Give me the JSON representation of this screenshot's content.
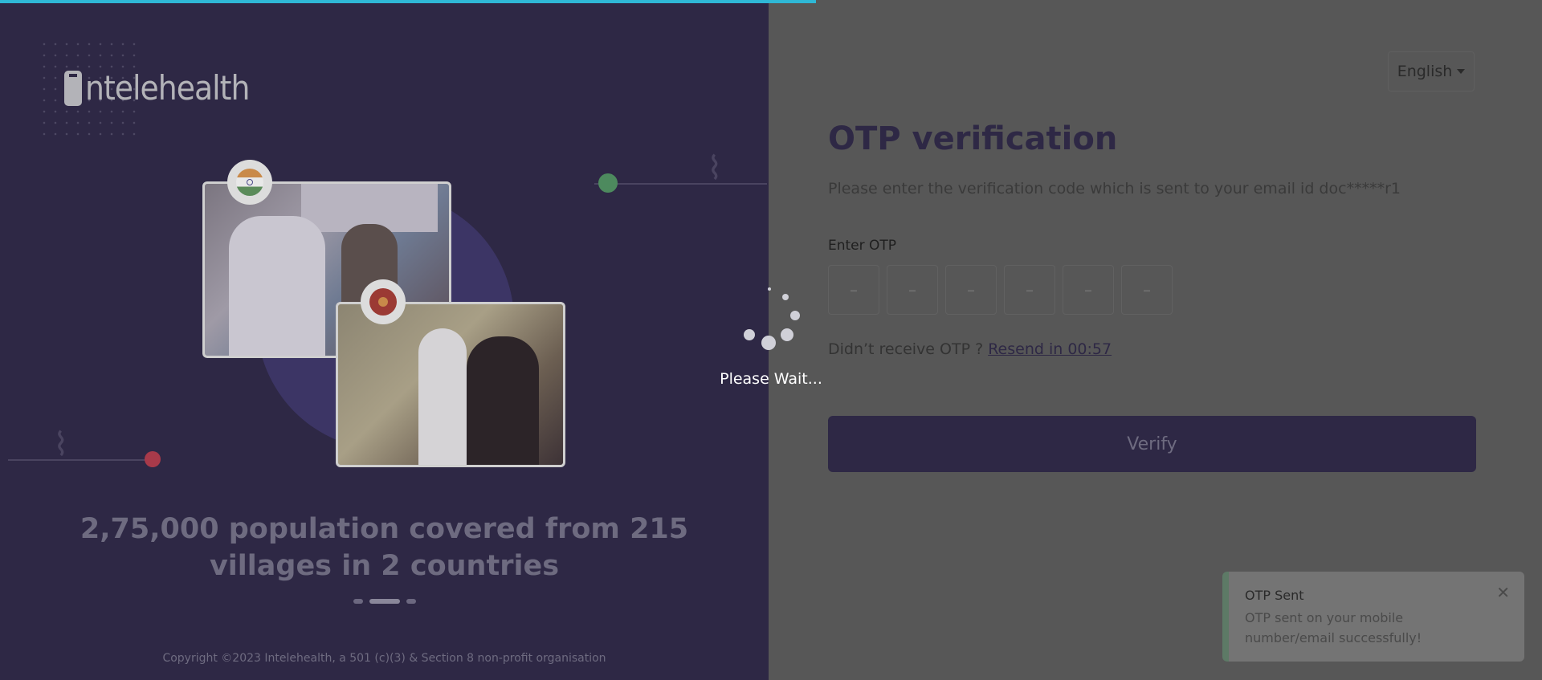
{
  "brand": {
    "logo_text": "ntelehealth"
  },
  "left_panel": {
    "headline": "2,75,000 population covered from 215 villages in 2 countries",
    "copyright": "Copyright ©2023 Intelehealth, a 501 (c)(3) & Section 8 non-profit organisation",
    "carousel": {
      "count": 3,
      "active_index": 1
    }
  },
  "language": {
    "selected": "English"
  },
  "otp": {
    "title": "OTP verification",
    "subtitle": "Please enter the verification code which is sent to your email id doc*****r1",
    "label": "Enter OTP",
    "boxes": [
      "–",
      "–",
      "–",
      "–",
      "–",
      "–"
    ],
    "resend_prefix": "Didn’t receive OTP ?",
    "resend_link": "Resend in 00:57",
    "verify_label": "Verify"
  },
  "toast": {
    "title": "OTP Sent",
    "message": "OTP sent on your mobile number/email successfully!",
    "close": "✕"
  },
  "loader": {
    "text": "Please Wait..."
  },
  "colors": {
    "accent": "#2e2845",
    "progress": "#2fb8d6",
    "overlay": "#575757"
  }
}
